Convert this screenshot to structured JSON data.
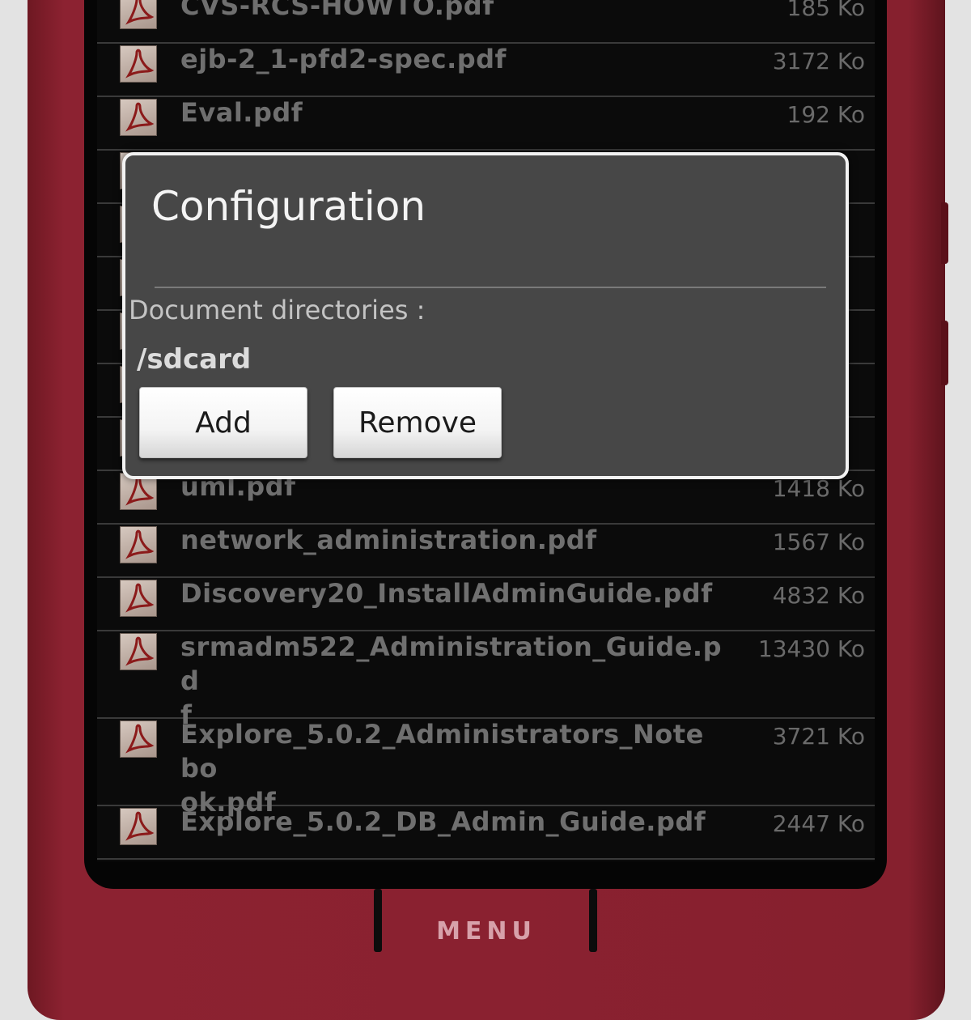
{
  "files": [
    {
      "name": "CVS-RCS-HOWTO.pdf",
      "size": "185 Ko",
      "rows": 1
    },
    {
      "name": "ejb-2_1-pfd2-spec.pdf",
      "size": "3172 Ko",
      "rows": 1
    },
    {
      "name": "Eval.pdf",
      "size": "192 Ko",
      "rows": 1
    },
    {
      "name": "",
      "size": "",
      "rows": 1
    },
    {
      "name": "",
      "size": "",
      "rows": 1
    },
    {
      "name": "",
      "size": "",
      "rows": 1
    },
    {
      "name": "",
      "size": "",
      "rows": 1
    },
    {
      "name": "",
      "size": "",
      "rows": 1
    },
    {
      "name": "",
      "size": "",
      "rows": 1
    },
    {
      "name": "uml.pdf",
      "size": "1418 Ko",
      "rows": 1
    },
    {
      "name": "network_administration.pdf",
      "size": "1567 Ko",
      "rows": 1
    },
    {
      "name": "Discovery20_InstallAdminGuide.pdf",
      "size": "4832 Ko",
      "rows": 1
    },
    {
      "name": "srmadm522_Administration_Guide.pd\nf",
      "size": "13430 Ko",
      "rows": 2
    },
    {
      "name": "Explore_5.0.2_Administrators_Notebo\nok.pdf",
      "size": "3721 Ko",
      "rows": 2
    },
    {
      "name": "Explore_5.0.2_DB_Admin_Guide.pdf",
      "size": "2447 Ko",
      "rows": 1
    }
  ],
  "dialog": {
    "title": "Configuration",
    "directories_label": "Document directories :",
    "directory": "/sdcard",
    "add_label": "Add",
    "remove_label": "Remove"
  },
  "menu_label": "MENU",
  "colors": {
    "phone_body": "#8a2130",
    "dialog_bg": "#474747",
    "file_text": "#6f6f6f"
  }
}
